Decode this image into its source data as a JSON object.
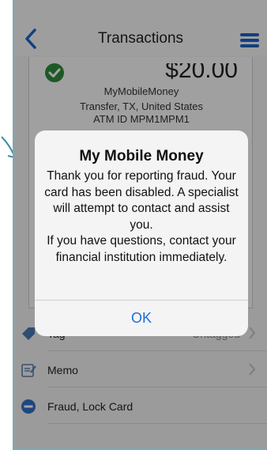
{
  "nav": {
    "title": "Transactions"
  },
  "transaction": {
    "amount": "$20.00",
    "merchant_name": "MyMobileMoney",
    "merchant_location": "Transfer, TX, United States",
    "atm_id": "ATM ID MPM1MPM1"
  },
  "rows": [
    {
      "label": "Tag",
      "value": "Untagged",
      "icon": "tag-icon"
    },
    {
      "label": "Memo",
      "value": "",
      "icon": "memo-icon"
    },
    {
      "label": "Fraud, Lock Card",
      "value": "",
      "icon": "minus-circle-icon"
    }
  ],
  "alert": {
    "title": "My Mobile Money",
    "message": "Thank you for reporting fraud. Your card has been disabled. A specialist will attempt to contact and assist you.\nIf you have questions, contact your financial institution immediately.",
    "ok_label": "OK"
  },
  "colors": {
    "accent": "#1d63c9",
    "ok_blue": "#1d6fd8",
    "success_green": "#2e8b3e",
    "fraud_blue": "#2f6fc9",
    "callout_teal": "#3b8ea5"
  }
}
